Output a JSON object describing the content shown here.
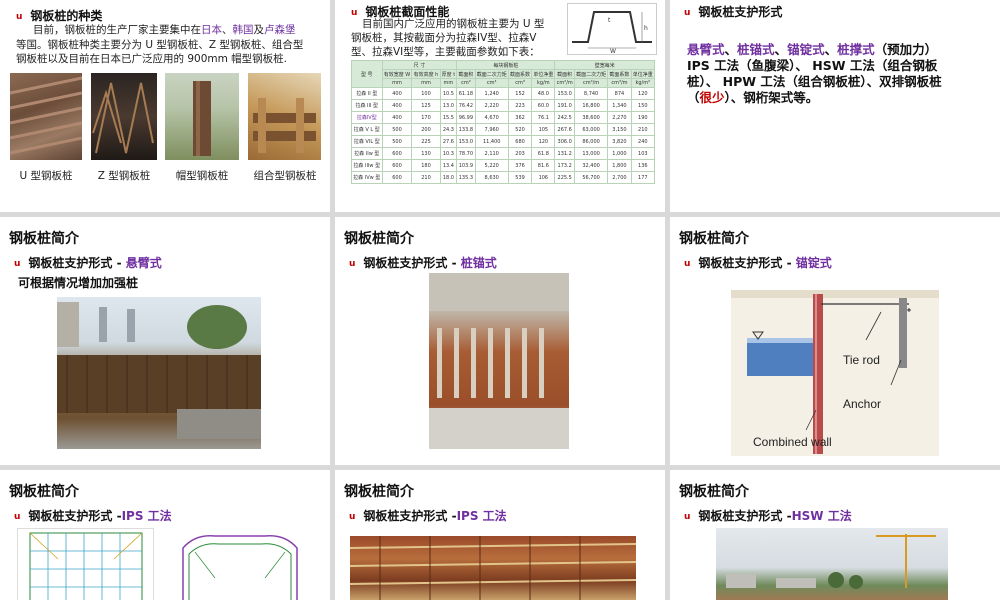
{
  "slide1": {
    "heading": "钢板桩的种类",
    "p1_pre": "目前，钢板桩的生产厂家主要集中在",
    "p1_japan": "日本",
    "p1_sep": "、",
    "p1_korea": "韩国",
    "p1_and": "及",
    "p1_lux": "卢森堡",
    "p2": "等国。钢板桩种类主要分为 U 型钢板桩、Z 型钢板桩、组合型",
    "p3": "钢板桩以及目前在日本已广泛应用的 900mm 帽型钢板桩.",
    "captions": [
      "U 型钢板桩",
      "Z 型钢板桩",
      "帽型钢板桩",
      "组合型钢板桩"
    ]
  },
  "slide2": {
    "heading": "钢板桩截面性能",
    "p1": "目前国内广泛应用的钢板桩主要为 U 型",
    "p2": "钢板桩，其按截面分为拉森IV型、拉森V",
    "p3": "型、拉森VI型等，主要截面参数如下表：",
    "diagram_labels": [
      "W",
      "h",
      "t"
    ],
    "table": {
      "h1": [
        "型 号",
        "尺 寸",
        "每块钢板桩",
        "壁宽每米"
      ],
      "h2": [
        "有效宽度 W",
        "有效高度 h",
        "厚度 t",
        "截面积",
        "截面二次力矩",
        "截面系数",
        "单位净重",
        "截面积",
        "截面二次力矩",
        "截面系数",
        "单位净重"
      ],
      "h3": [
        "mm",
        "mm",
        "mm",
        "cm²",
        "cm⁴",
        "cm³",
        "kg/m",
        "cm²/m",
        "cm⁴/m",
        "cm³/m",
        "kg/m²"
      ],
      "rows": [
        [
          "拉森 II 型",
          "400",
          "100",
          "10.5",
          "61.18",
          "1,240",
          "152",
          "48.0",
          "153.0",
          "8,740",
          "874",
          "120"
        ],
        [
          "拉森 III 型",
          "400",
          "125",
          "13.0",
          "76.42",
          "2,220",
          "223",
          "60.0",
          "191.0",
          "16,800",
          "1,340",
          "150"
        ],
        [
          "拉森IV型",
          "400",
          "170",
          "15.5",
          "96.99",
          "4,670",
          "362",
          "76.1",
          "242.5",
          "38,600",
          "2,270",
          "190"
        ],
        [
          "拉森 V L 型",
          "500",
          "200",
          "24.3",
          "133.8",
          "7,960",
          "520",
          "105",
          "267.6",
          "63,000",
          "3,150",
          "210"
        ],
        [
          "拉森 VIL 型",
          "500",
          "225",
          "27.6",
          "153.0",
          "11,400",
          "680",
          "120",
          "306.0",
          "86,000",
          "3,820",
          "240"
        ],
        [
          "拉森 IIw 型",
          "600",
          "130",
          "10.3",
          "78.70",
          "2,110",
          "203",
          "61.8",
          "131.2",
          "13,000",
          "1,000",
          "103"
        ],
        [
          "拉森 IIIw 型",
          "600",
          "180",
          "13.4",
          "103.9",
          "5,220",
          "376",
          "81.6",
          "173.2",
          "32,400",
          "1,800",
          "136"
        ],
        [
          "拉森 IVw 型",
          "600",
          "210",
          "18.0",
          "135.3",
          "8,630",
          "539",
          "106",
          "225.5",
          "56,700",
          "2,700",
          "177"
        ]
      ]
    }
  },
  "slide3": {
    "bullet": "钢板桩支护形式",
    "l1": [
      "悬臂式",
      "、",
      "桩锚式",
      "、",
      "锚锭式",
      "、",
      "桩撑式",
      "（预加力）"
    ],
    "l2": "IPS 工法（鱼腹梁）、 HSW 工法（组合钢板",
    "l3": "桩）、 HPW 工法（组合钢板桩）、双排钢板桩",
    "l4": [
      "（",
      "很少",
      "）、钢桁架式等。"
    ]
  },
  "slide4": {
    "title": "钢板桩简介",
    "bullet_pre": "钢板桩支护形式 - ",
    "bullet_hl": "悬臂式",
    "sub": "可根据情况增加加强桩"
  },
  "slide5": {
    "title": "钢板桩简介",
    "bullet_pre": "钢板桩支护形式 - ",
    "bullet_hl": "桩锚式"
  },
  "slide6": {
    "title": "钢板桩简介",
    "bullet_pre": "钢板桩支护形式 - ",
    "bullet_hl": "锚锭式",
    "labels": [
      "Tie rod",
      "Anchor",
      "Combined wall"
    ]
  },
  "slide7": {
    "title": "钢板桩简介",
    "bullet_pre": "钢板桩支护形式 -",
    "bullet_hl": "IPS 工法"
  },
  "slide8": {
    "title": "钢板桩简介",
    "bullet_pre": "钢板桩支护形式 -",
    "bullet_hl": "IPS 工法"
  },
  "slide9": {
    "title": "钢板桩简介",
    "bullet_pre": "钢板桩支护形式 -",
    "bullet_hl": "HSW 工法"
  },
  "colors": {
    "accent_purple": "#7030a0",
    "accent_red": "#c00000",
    "background": "#d9d9d9"
  }
}
